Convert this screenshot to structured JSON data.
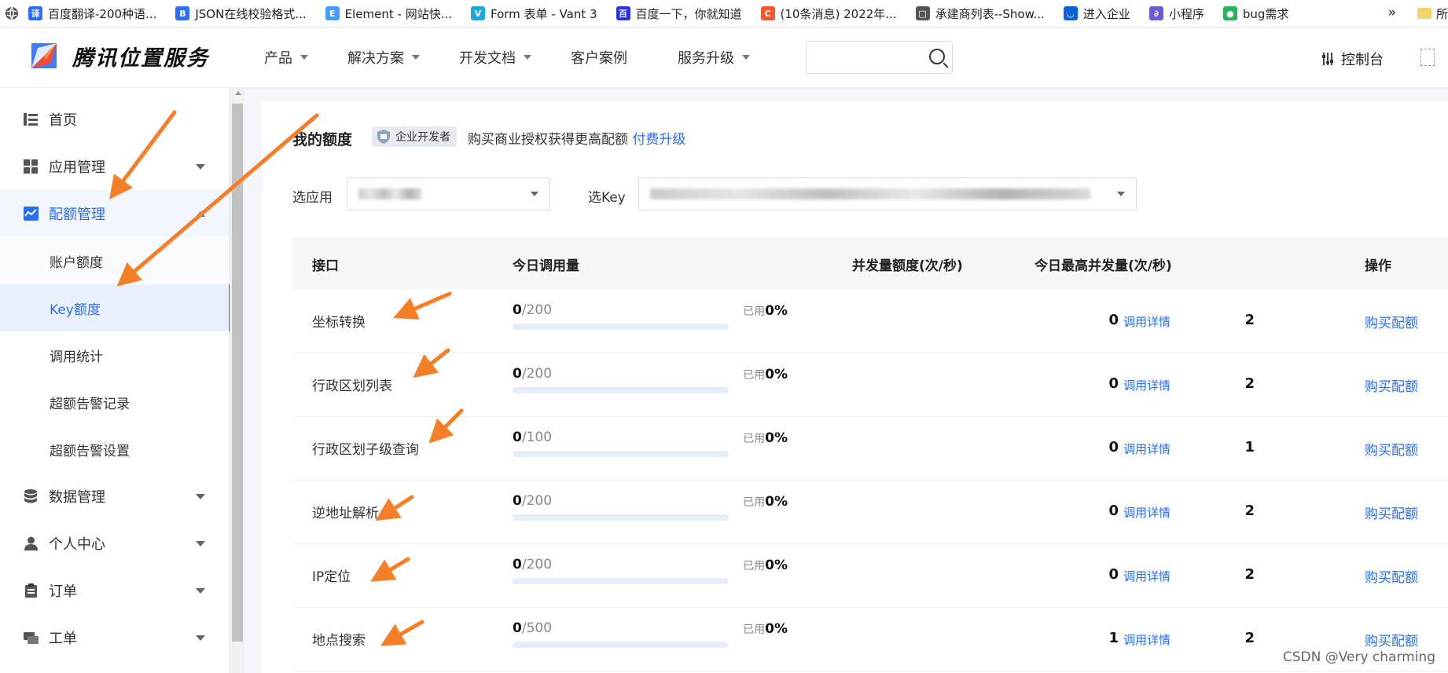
{
  "bookmarks": [
    {
      "label": "百度翻译-200种语...",
      "icon": "baidu-translate-icon",
      "color": "#2f6df6",
      "glyph": "译"
    },
    {
      "label": "JSON在线校验格式...",
      "icon": "json-icon",
      "color": "#2f6df6",
      "glyph": "B"
    },
    {
      "label": "Element - 网站快...",
      "icon": "element-icon",
      "color": "#409eff",
      "glyph": "E"
    },
    {
      "label": "Form 表单 - Vant 3",
      "icon": "vant-icon",
      "color": "#1fa8e0",
      "glyph": "V"
    },
    {
      "label": "百度一下，你就知道",
      "icon": "baidu-icon",
      "color": "#2932e1",
      "glyph": "百"
    },
    {
      "label": "(10条消息) 2022年...",
      "icon": "csdn-icon",
      "color": "#fc5531",
      "glyph": "C"
    },
    {
      "label": "承建商列表--Show...",
      "icon": "page-icon",
      "color": "#555555",
      "glyph": "□"
    },
    {
      "label": "进入企业",
      "icon": "enterprise-icon",
      "color": "#0a62d6",
      "glyph": "◡"
    },
    {
      "label": "小程序",
      "icon": "miniprogram-icon",
      "color": "#6b5bd6",
      "glyph": "∂"
    },
    {
      "label": "bug需求",
      "icon": "bug-icon",
      "color": "#28b25b",
      "glyph": "●"
    }
  ],
  "bookmarks_more": "»",
  "bookmarks_folder": "所",
  "brand": {
    "name": "腾讯位置服务"
  },
  "nav": [
    {
      "label": "产品",
      "dropdown": true
    },
    {
      "label": "解决方案",
      "dropdown": true
    },
    {
      "label": "开发文档",
      "dropdown": true
    },
    {
      "label": "客户案例",
      "dropdown": false
    },
    {
      "label": "服务升级",
      "dropdown": true
    }
  ],
  "search": {
    "placeholder": ""
  },
  "console_label": "控制台",
  "sidebar": {
    "items": [
      {
        "label": "首页",
        "icon": "home-list-icon"
      },
      {
        "label": "应用管理",
        "icon": "apps-grid-icon"
      },
      {
        "label": "配额管理",
        "icon": "quota-chart-icon"
      },
      {
        "label": "账户额度"
      },
      {
        "label": "Key额度"
      },
      {
        "label": "调用统计"
      },
      {
        "label": "超额告警记录"
      },
      {
        "label": "超额告警设置"
      },
      {
        "label": "数据管理",
        "icon": "database-icon"
      },
      {
        "label": "个人中心",
        "icon": "user-icon"
      },
      {
        "label": "订单",
        "icon": "clipboard-icon"
      },
      {
        "label": "工单",
        "icon": "ticket-icon"
      }
    ]
  },
  "quota": {
    "title": "我的额度",
    "badge": "企业开发者",
    "promo_text": "购买商业授权获得更高配额",
    "upgrade_link": "付费升级"
  },
  "filters": {
    "app_label": "选应用",
    "key_label": "选Key"
  },
  "table": {
    "headers": [
      "接口",
      "今日调用量",
      "并发量额度(次/秒)",
      "今日最高并发量(次/秒)",
      "操作"
    ],
    "used_prefix": "已用",
    "detail_label": "调用详情",
    "buy_label": "购买配额",
    "rows": [
      {
        "name": "坐标转换",
        "used": "0",
        "total": "/200",
        "percent": "0%",
        "ratio": 0,
        "concurrency": "2",
        "peak": "0"
      },
      {
        "name": "行政区划列表",
        "used": "0",
        "total": "/200",
        "percent": "0%",
        "ratio": 0,
        "concurrency": "2",
        "peak": "0"
      },
      {
        "name": "行政区划子级查询",
        "used": "0",
        "total": "/100",
        "percent": "0%",
        "ratio": 0,
        "concurrency": "1",
        "peak": "0"
      },
      {
        "name": "逆地址解析",
        "used": "0",
        "total": "/200",
        "percent": "0%",
        "ratio": 0,
        "concurrency": "2",
        "peak": "0"
      },
      {
        "name": "IP定位",
        "used": "0",
        "total": "/200",
        "percent": "0%",
        "ratio": 0,
        "concurrency": "2",
        "peak": "0"
      },
      {
        "name": "地点搜索",
        "used": "0",
        "total": "/500",
        "percent": "0%",
        "ratio": 0,
        "concurrency": "2",
        "peak": "1"
      }
    ]
  },
  "watermark": "CSDN @Very charming",
  "colors": {
    "accent": "#2a6ef0",
    "annotation_arrow": "#f57f28"
  }
}
